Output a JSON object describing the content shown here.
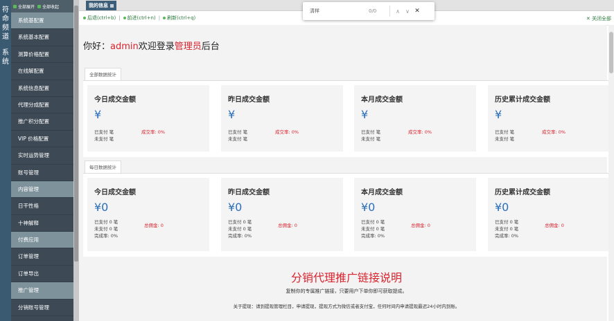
{
  "left_tab": {
    "line1": "符命频道",
    "line2": "系统"
  },
  "sidebar": {
    "expand_all": "全部展开",
    "collapse_all": "全部收起",
    "items": [
      {
        "label": "系统基配置",
        "header": true
      },
      {
        "label": "系统基本配置",
        "header": false
      },
      {
        "label": "测算价格配置",
        "header": false
      },
      {
        "label": "在线解配置",
        "header": false
      },
      {
        "label": "系统信息配置",
        "header": false
      },
      {
        "label": "代理分成配置",
        "header": false
      },
      {
        "label": "推广积分配置",
        "header": false
      },
      {
        "label": "VIP 价格配置",
        "header": false
      },
      {
        "label": "实时运势管理",
        "header": false
      },
      {
        "label": "账号管理",
        "header": false
      },
      {
        "label": "内容管理",
        "header": true
      },
      {
        "label": "日干性格",
        "header": false
      },
      {
        "label": "十神解释",
        "header": false
      },
      {
        "label": "付费应用",
        "header": true
      },
      {
        "label": "订单管理",
        "header": false
      },
      {
        "label": "订单导出",
        "header": false
      },
      {
        "label": "推广管理",
        "header": true
      },
      {
        "label": "分销账号管理",
        "header": false
      }
    ]
  },
  "tabs": [
    {
      "label": "我的信息"
    }
  ],
  "toolbar": {
    "back": "后退(ctrl+b)",
    "forward": "前进(ctrl+n)",
    "refresh": "刷新(ctrl+q)",
    "close_all": "关闭全部"
  },
  "find": {
    "query": "清样",
    "count": "0/0"
  },
  "greeting": {
    "prefix": "你好：",
    "user": "admin",
    "middle": "欢迎登录",
    "role": "管理员",
    "suffix": "后台"
  },
  "section_all": {
    "title": "全部数据统计",
    "cards": [
      {
        "title": "今日成交金额",
        "amount": "¥",
        "paid": "已支付 笔",
        "unpaid": "未支付 笔",
        "rate": "成交率: 0%"
      },
      {
        "title": "昨日成交金额",
        "amount": "¥",
        "paid": "已支付 笔",
        "unpaid": "未支付 笔",
        "rate": "成交率: 0%"
      },
      {
        "title": "本月成交金额",
        "amount": "¥",
        "paid": "已支付 笔",
        "unpaid": "未支付 笔",
        "rate": "成交率: 0%"
      },
      {
        "title": "历史累计成交金额",
        "amount": "¥",
        "paid": "已支付 笔",
        "unpaid": "未支付 笔",
        "rate": "成交率: 0%"
      }
    ]
  },
  "section_daily": {
    "title": "每日数据统计",
    "cards": [
      {
        "title": "今日成交金额",
        "amount": "¥0",
        "paid": "已支付 0 笔",
        "unpaid": "未支付 0 笔",
        "complete": "完成率: 0%",
        "commission": "总佣金: 0"
      },
      {
        "title": "昨日成交金额",
        "amount": "¥0",
        "paid": "已支付 0 笔",
        "unpaid": "未支付 0 笔",
        "complete": "完成率: 0%",
        "commission": "总佣金: 0"
      },
      {
        "title": "本月成交金额",
        "amount": "¥0",
        "paid": "已支付 0 笔",
        "unpaid": "未支付 0 笔",
        "complete": "完成率: 0%",
        "commission": "总佣金: 0"
      },
      {
        "title": "历史累计成交金额",
        "amount": "¥0",
        "paid": "已支付 0 笔",
        "unpaid": "未支付 0 笔",
        "complete": "完成率: 0%",
        "commission": "总佣金: 0"
      }
    ]
  },
  "promo": {
    "title": "分销代理推广链接说明",
    "line1": "复制你的专属推广链接，只要用户下单你即可获取提成。",
    "line2": "关于提现：请到提现管理栏目，申请提现，提现方式为微信或者支付宝，任何时间内申请提现最迟24小时内到账。"
  }
}
